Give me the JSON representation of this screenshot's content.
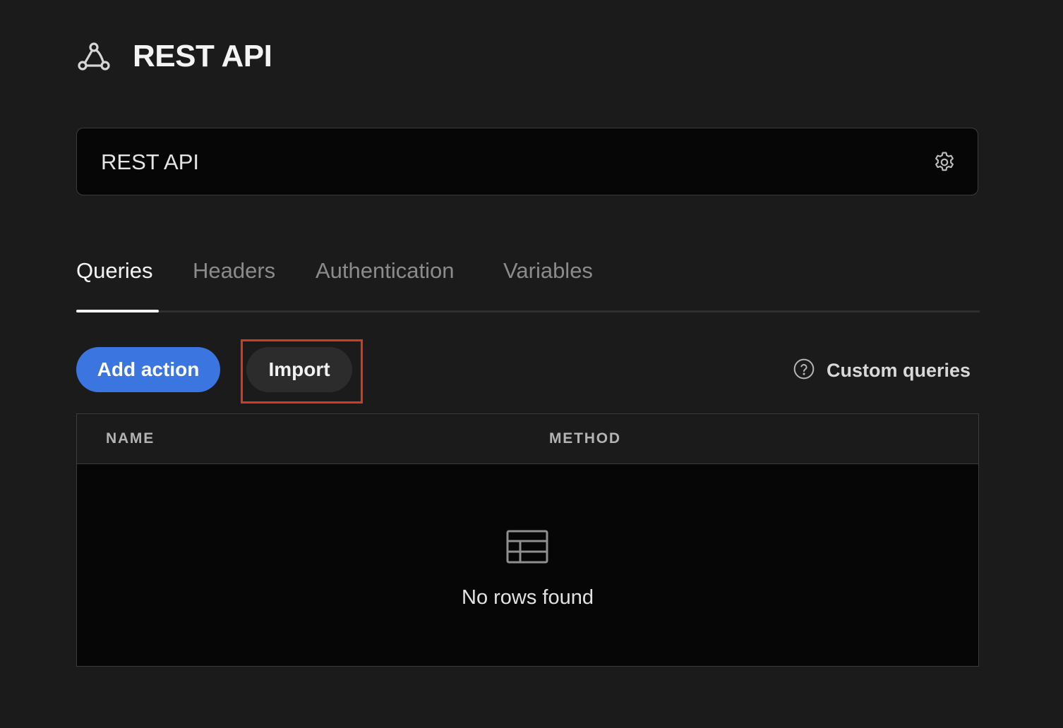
{
  "header": {
    "title": "REST API",
    "icon": "webhook-icon"
  },
  "name_field": {
    "value": "REST API",
    "icon": "gear-icon"
  },
  "tabs": [
    {
      "label": "Queries",
      "active": true
    },
    {
      "label": "Headers",
      "active": false
    },
    {
      "label": "Authentication",
      "active": false
    },
    {
      "label": "Variables",
      "active": false
    }
  ],
  "toolbar": {
    "add_action_label": "Add action",
    "import_label": "Import",
    "custom_queries_label": "Custom queries",
    "help_icon": "question-circle-icon"
  },
  "table": {
    "columns": [
      "NAME",
      "METHOD"
    ],
    "rows": [],
    "empty_icon": "table-icon",
    "empty_text": "No rows found"
  },
  "colors": {
    "background": "#1b1b1b",
    "input_background": "#060606",
    "primary_button": "#3a75e0",
    "secondary_button": "#2c2c2c",
    "highlight_border": "#d23a22"
  }
}
